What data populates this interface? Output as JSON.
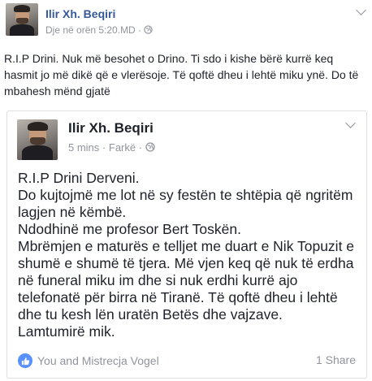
{
  "post": {
    "author": "Ilir Xh. Beqiri",
    "timestamp": "Dje në orën 5:20.MD",
    "separator": "·",
    "text_lines": [
      "R.I.P Drini. Nuk më besohet o Drino. Ti sdo i kishe bërë kurrë keq",
      "hasmit jo më dikë që e vlerësoje. Të qoftë dheu i lehtë miku ynë. Do të",
      "mbahesh mënd gjatë"
    ]
  },
  "shared_post": {
    "author": "Ilir Xh. Beqiri",
    "time": "5 mins",
    "separator": "·",
    "location": "Farkë",
    "lines": [
      "R.I.P Drini Derveni.",
      "Do kujtojmë me lot në sy festën te shtëpia që ngritëm",
      "lagjen në këmbë.",
      "Ndodhinë me profesor Bert Toskën.",
      "Mbrëmjen e maturës e telljet me duart e Nik Topuzit e",
      "shumë e shumë të tjera. Më vjen keq që nuk të erdha",
      "në funeral miku im dhe si nuk erdhi kurrë ajo",
      "telefonatë për birra në Tiranë. Të qoftë dheu i lehtë",
      "dhe tu kesh lën uratën Betës dhe vajzave.",
      "Lamtumirë mik."
    ],
    "reactions": "You and Mistrecja Vogel",
    "shares": "1 Share"
  },
  "icons": {
    "privacy": "globe-icon",
    "like": "thumbs-up-icon",
    "menu": "chevron-down-icon"
  },
  "colors": {
    "author_link": "#365899",
    "meta_gray": "#90949c",
    "like_blue": "#5890ff",
    "card_border": "#dddfe2"
  }
}
